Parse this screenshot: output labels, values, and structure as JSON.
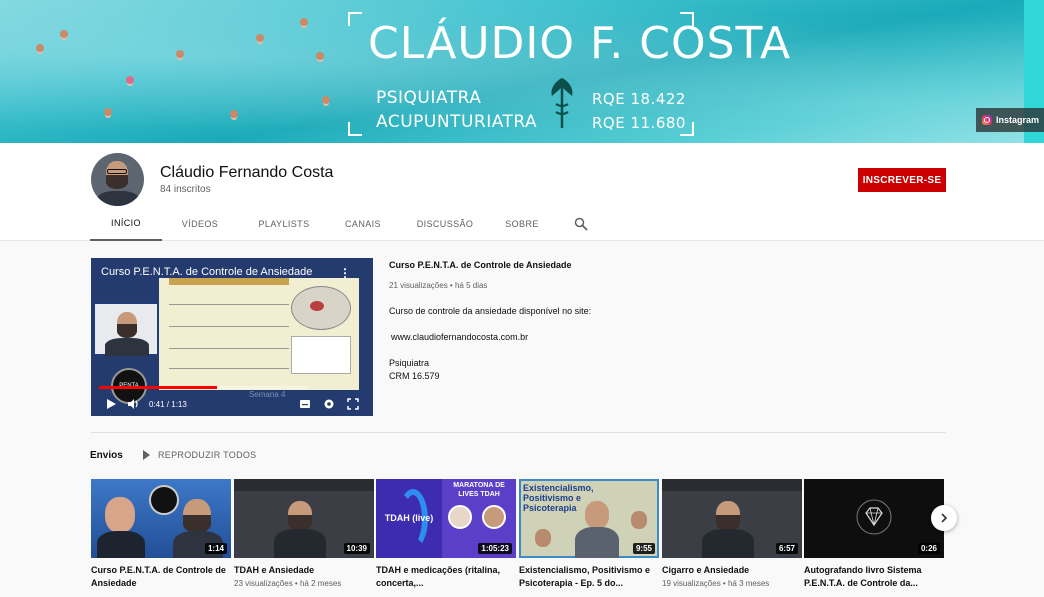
{
  "banner": {
    "name": "CLÁUDIO F. COSTA",
    "line1_left": "PSIQUIATRA",
    "line1_right": "RQE 18.422",
    "line2_left": "ACUPUNTURIATRA",
    "line2_right": "RQE 11.680",
    "instagram_label": "Instagram"
  },
  "channel": {
    "name": "Cláudio Fernando Costa",
    "subscribers": "84 inscritos",
    "subscribe_label": "INSCREVER-SE"
  },
  "tabs": [
    {
      "label": "INÍCIO",
      "active": true
    },
    {
      "label": "VÍDEOS",
      "active": false
    },
    {
      "label": "PLAYLISTS",
      "active": false
    },
    {
      "label": "CANAIS",
      "active": false
    },
    {
      "label": "DISCUSSÃO",
      "active": false
    },
    {
      "label": "SOBRE",
      "active": false
    }
  ],
  "featured": {
    "player_title": "Curso P.E.N.T.A. de Controle de Ansiedade",
    "week_label": "Semana 4",
    "logo_text": "PENTA",
    "time": "0:41 / 1:13",
    "progress": 0.56,
    "title": "Curso P.E.N.T.A. de Controle de Ansiedade",
    "meta": "21 visualizações • há 5 dias",
    "desc1": "Curso de controle da ansiedade disponível no site:",
    "desc2": "www.claudiofernandocosta.com.br",
    "desc3": "Psiquiatra",
    "desc4": "CRM 16.579"
  },
  "envios": {
    "title": "Envios",
    "play_all": "REPRODUZIR TODOS",
    "videos": [
      {
        "title": "Curso P.E.N.T.A. de Controle de Ansiedade",
        "meta": "",
        "duration": "1:14",
        "thumb_bg": "#2f5fa8"
      },
      {
        "title": "TDAH e Ansiedade",
        "meta": "23 visualizações • há 2 meses",
        "duration": "10:39",
        "thumb_bg": "#3b3e45"
      },
      {
        "title": "TDAH e medicações (ritalina, concerta,...",
        "meta": "",
        "duration": "1:05:23",
        "thumb_bg": "#4a35b8"
      },
      {
        "title": "Existencialismo, Positivismo e Psicoterapia - Ep. 5 do...",
        "meta": "",
        "duration": "9:55",
        "thumb_bg": "#c9cdb0"
      },
      {
        "title": "Cigarro e Ansiedade",
        "meta": "19 visualizações • há 3 meses",
        "duration": "6:57",
        "thumb_bg": "#3b3e45"
      },
      {
        "title": "Autografando livro Sistema P.E.N.T.A. de Controle da...",
        "meta": "",
        "duration": "0:26",
        "thumb_bg": "#0e0e0e"
      }
    ],
    "thumb_texts": {
      "tdah_live": "TDAH (live)",
      "maratona": "MARATONA DE LIVES TDAH",
      "existencialismo": "Existencialismo, Positivismo e Psicoterapia"
    }
  },
  "colors": {
    "subscribe": "#cc0000",
    "progress": "#ff0000"
  }
}
